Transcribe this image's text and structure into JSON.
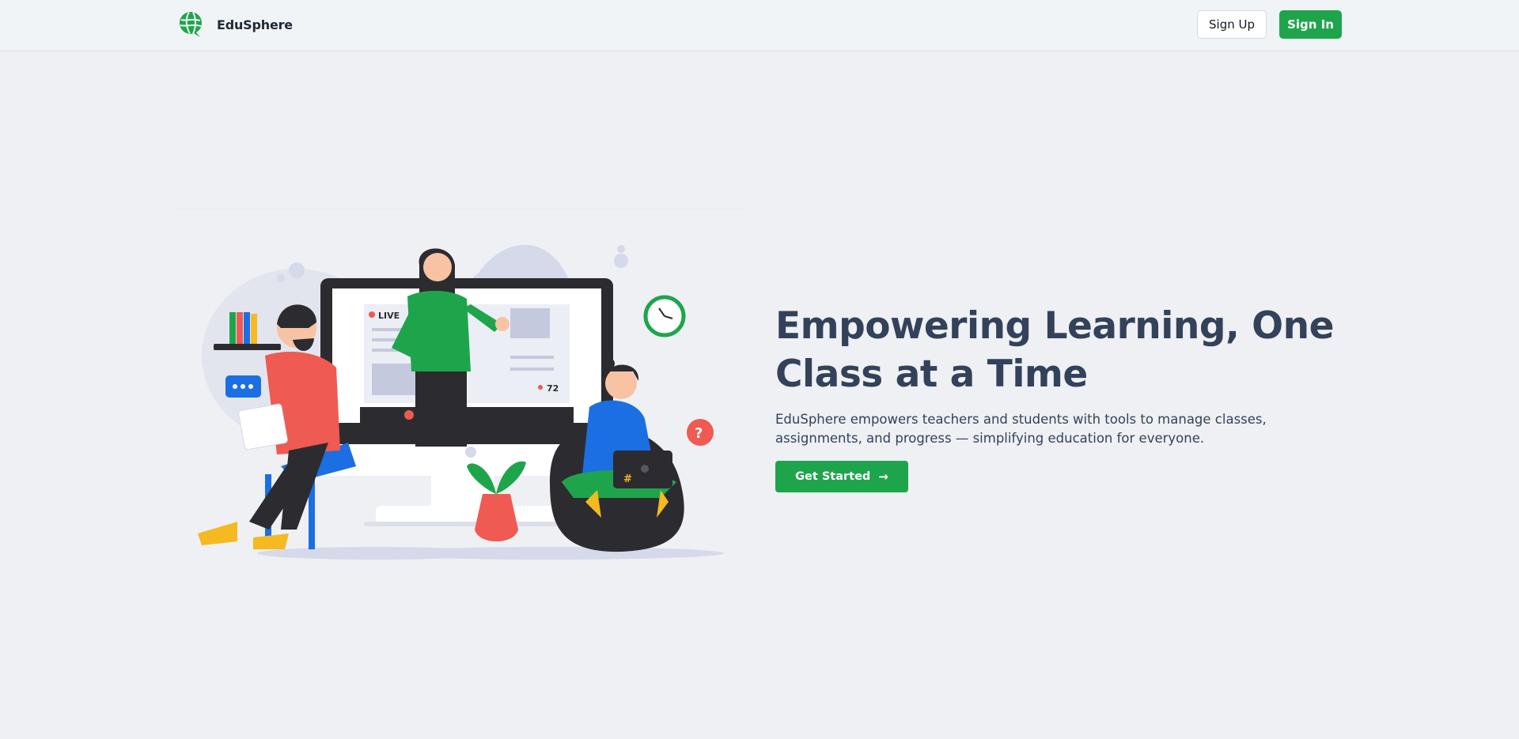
{
  "header": {
    "brand_name": "EduSphere",
    "logo_icon": "globe-chat-icon",
    "signup_label": "Sign Up",
    "signin_label": "Sign In"
  },
  "hero": {
    "title": "Empowering Learning, One Class at a Time",
    "description": "EduSphere empowers teachers and students with tools to manage classes, assignments, and progress — simplifying education for everyone.",
    "cta_label": "Get Started",
    "cta_icon": "arrow-right-icon"
  },
  "illustration": {
    "live_label": "LIVE",
    "viewer_count": "72"
  },
  "colors": {
    "brand_green": "#1ea54c",
    "heading": "#33425a",
    "background": "#eef0f4",
    "header_bg": "#f1f4f6"
  }
}
